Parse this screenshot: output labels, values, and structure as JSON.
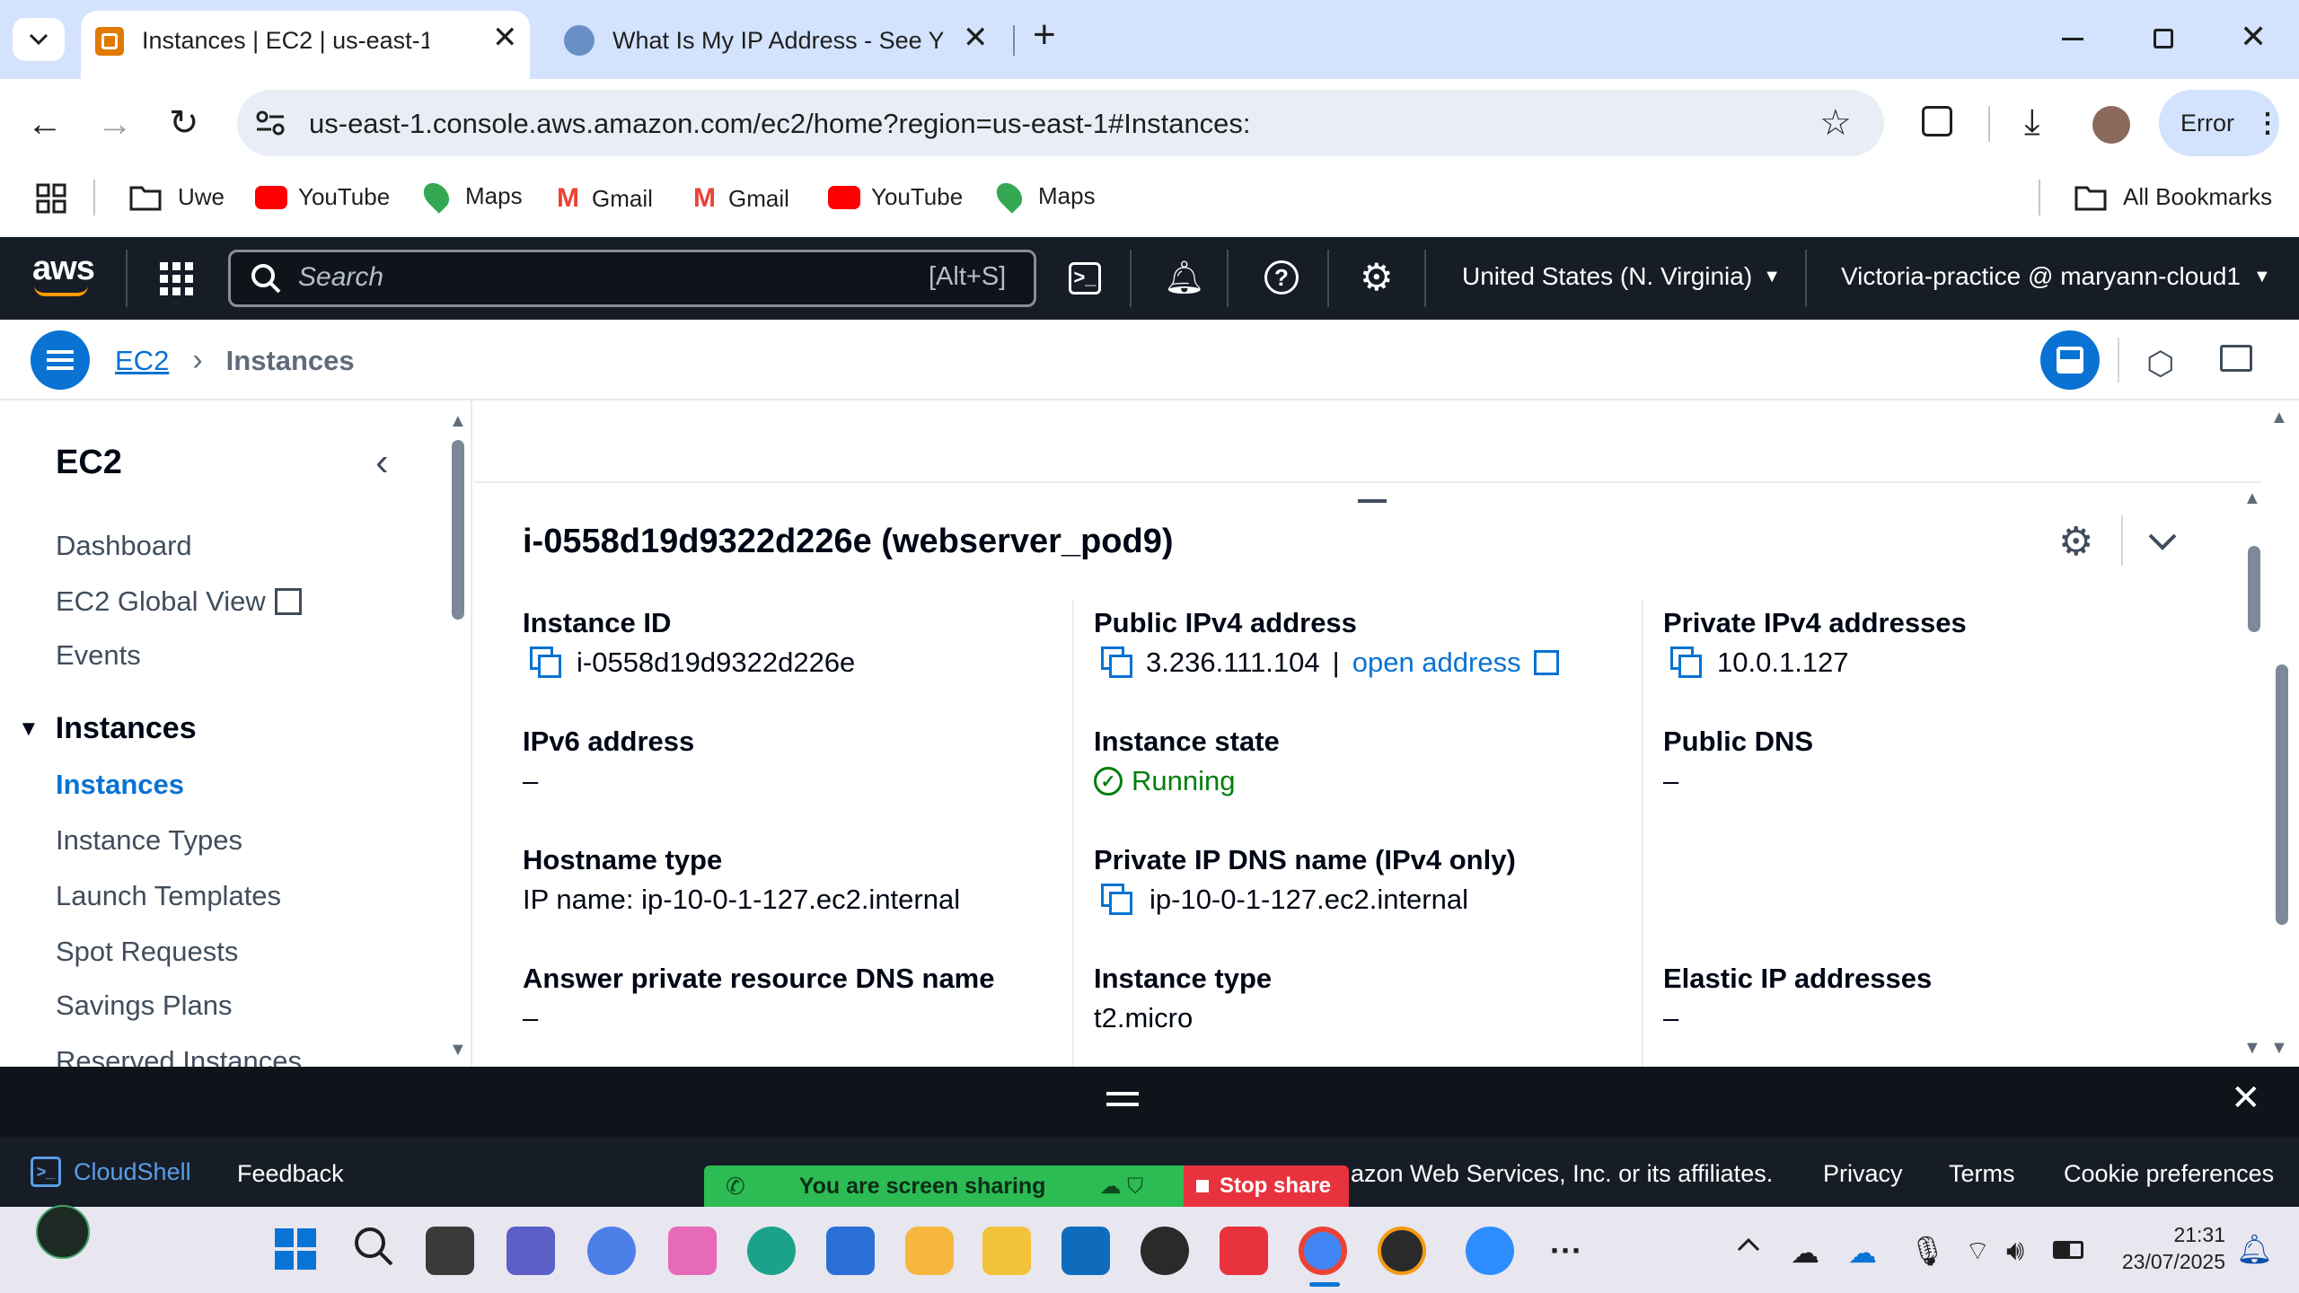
{
  "browser": {
    "tabs": [
      {
        "title": "Instances | EC2 | us-east-1",
        "active": true
      },
      {
        "title": "What Is My IP Address - See Yo",
        "active": false
      }
    ],
    "url": "us-east-1.console.aws.amazon.com/ec2/home?region=us-east-1#Instances:",
    "profile_status": "Error",
    "bookmarks": [
      {
        "label": "Uwe",
        "icon": "folder-icon"
      },
      {
        "label": "YouTube",
        "icon": "youtube-icon"
      },
      {
        "label": "Maps",
        "icon": "maps-icon"
      },
      {
        "label": "Gmail",
        "icon": "gmail-icon"
      },
      {
        "label": "Gmail",
        "icon": "gmail-icon"
      },
      {
        "label": "YouTube",
        "icon": "youtube-icon"
      },
      {
        "label": "Maps",
        "icon": "maps-icon"
      }
    ],
    "all_bookmarks": "All Bookmarks"
  },
  "aws_nav": {
    "logo": "aws",
    "search_placeholder": "Search",
    "search_shortcut": "[Alt+S]",
    "region": "United States (N. Virginia)",
    "account": "Victoria-practice @ maryann-cloud1"
  },
  "breadcrumb": {
    "service": "EC2",
    "current": "Instances"
  },
  "sidebar": {
    "title": "EC2",
    "items": [
      "Dashboard",
      "EC2 Global View",
      "Events"
    ],
    "section": "Instances",
    "section_items": [
      "Instances",
      "Instance Types",
      "Launch Templates",
      "Spot Requests",
      "Savings Plans",
      "Reserved Instances"
    ]
  },
  "details": {
    "heading": "i-0558d19d9322d226e (webserver_pod9)",
    "col1": [
      {
        "label": "Instance ID",
        "value": "i-0558d19d9322d226e"
      },
      {
        "label": "IPv6 address",
        "value": "–"
      },
      {
        "label": "Hostname type",
        "value": "IP name: ip-10-0-1-127.ec2.internal"
      },
      {
        "label": "Answer private resource DNS name",
        "value": "–"
      }
    ],
    "col2": [
      {
        "label": "Public IPv4 address",
        "value": "3.236.111.104",
        "sep": "|",
        "link": "open address"
      },
      {
        "label": "Instance state",
        "value": "Running"
      },
      {
        "label": "Private IP DNS name (IPv4 only)",
        "value": "ip-10-0-1-127.ec2.internal"
      },
      {
        "label": "Instance type",
        "value": "t2.micro"
      }
    ],
    "col3": [
      {
        "label": "Private IPv4 addresses",
        "value": "10.0.1.127"
      },
      {
        "label": "Public DNS",
        "value": "–"
      },
      {
        "label": "Elastic IP addresses",
        "value": "–"
      }
    ]
  },
  "footer": {
    "cloudshell": "CloudShell",
    "feedback": "Feedback",
    "copyright": "azon Web Services, Inc. or its affiliates.",
    "links": [
      "Privacy",
      "Terms",
      "Cookie preferences"
    ]
  },
  "screen_share": {
    "status": "You are screen sharing",
    "stop": "Stop share"
  },
  "taskbar": {
    "time": "21:31",
    "date": "23/07/2025"
  },
  "colors": {
    "aws_nav_bg": "#161d26",
    "link": "#0972d3",
    "running": "#037f0c",
    "chrome_tabstrip": "#d3e3fd"
  }
}
